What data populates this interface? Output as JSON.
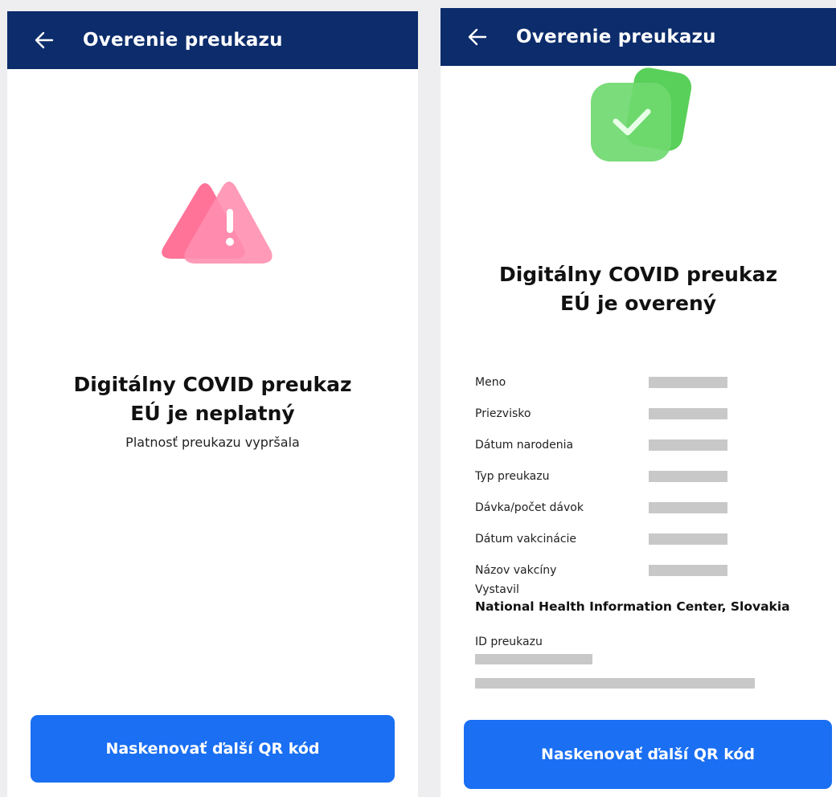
{
  "left": {
    "header_title": "Overenie preukazu",
    "headline": "Digitálny COVID preukaz EÚ je neplatný",
    "subtitle": "Platnosť preukazu vypršala",
    "button_label": "Naskenovať ďalší QR kód"
  },
  "right": {
    "header_title": "Overenie preukazu",
    "headline": "Digitálny COVID preukaz EÚ je overený",
    "fields": [
      {
        "label": "Meno"
      },
      {
        "label": "Priezvisko"
      },
      {
        "label": "Dátum narodenia"
      },
      {
        "label": "Typ preukazu"
      },
      {
        "label": "Dávka/počet dávok"
      },
      {
        "label": "Dátum vakcinácie"
      },
      {
        "label": "Názov vakcíny"
      }
    ],
    "issuer_label": "Vystavil",
    "issuer_value": "National Health Information Center, Slovakia",
    "id_label": "ID preukazu",
    "button_label": "Naskenovať ďalší QR kód"
  },
  "colors": {
    "header_bg": "#0c2c6b",
    "button_bg": "#1a6ff2",
    "error_pink": "#ff7fa0",
    "success_green": "#5fd65f"
  },
  "icons": {
    "back": "arrow-left-icon",
    "invalid": "warning-triangle-icon",
    "valid": "check-badge-icon"
  }
}
